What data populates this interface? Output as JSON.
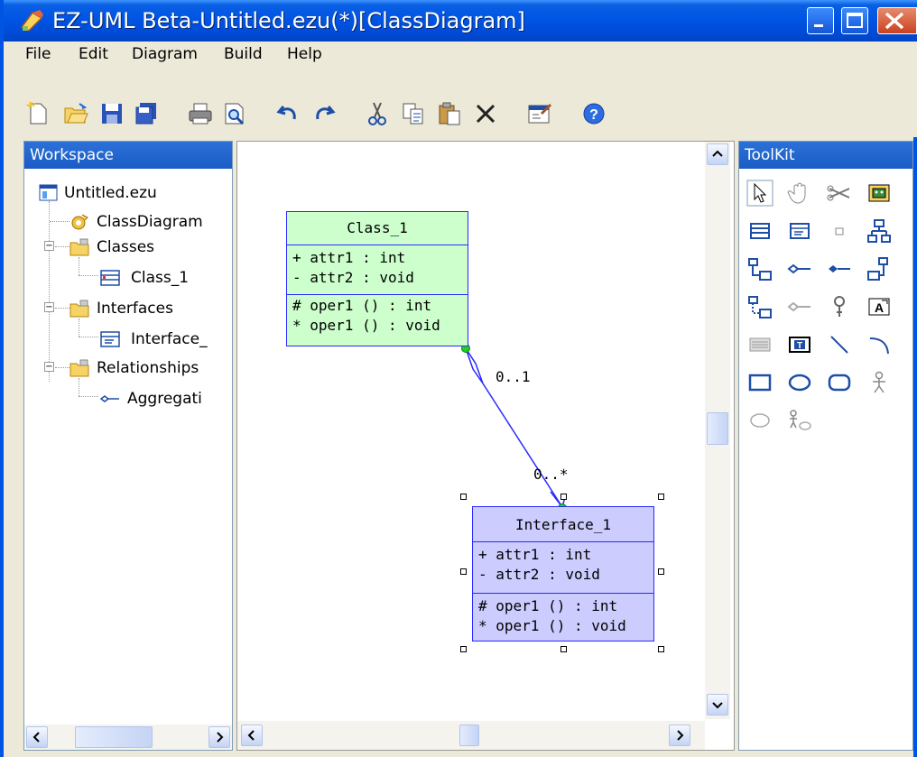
{
  "window": {
    "title": "EZ-UML Beta-Untitled.ezu(*)[ClassDiagram]"
  },
  "menu": [
    {
      "label": "File"
    },
    {
      "label": "Edit"
    },
    {
      "label": "Diagram"
    },
    {
      "label": "Build"
    },
    {
      "label": "Help"
    }
  ],
  "toolbar": [
    {
      "icon": "new-file-icon"
    },
    {
      "icon": "open-folder-icon"
    },
    {
      "icon": "save-icon"
    },
    {
      "icon": "save-all-icon"
    },
    {
      "icon": "print-icon"
    },
    {
      "icon": "print-preview-icon"
    },
    {
      "icon": "undo-icon"
    },
    {
      "icon": "redo-icon"
    },
    {
      "icon": "cut-icon"
    },
    {
      "icon": "copy-icon"
    },
    {
      "icon": "paste-icon"
    },
    {
      "icon": "delete-icon"
    },
    {
      "icon": "properties-icon"
    },
    {
      "icon": "help-icon"
    }
  ],
  "workspace": {
    "header": "Workspace",
    "tree": [
      {
        "label": "Untitled.ezu",
        "icon": "project-icon"
      },
      {
        "label": "ClassDiagram",
        "icon": "diagram-gear-icon"
      },
      {
        "label": "Classes",
        "icon": "folder-icon",
        "expander": "−"
      },
      {
        "label": "Class_1",
        "icon": "class-icon"
      },
      {
        "label": "Interfaces",
        "icon": "folder-icon",
        "expander": "−"
      },
      {
        "label": "Interface_",
        "icon": "interface-icon"
      },
      {
        "label": "Relationships",
        "icon": "folder-icon",
        "expander": "−"
      },
      {
        "label": "Aggregati",
        "icon": "aggregation-icon"
      }
    ]
  },
  "diagram": {
    "class1": {
      "name": "Class_1",
      "attr1": "+   attr1  : int",
      "attr2": "-   attr2  : void",
      "op1": "#   oper1 () : int",
      "op2": "*   oper1 () : void",
      "fill": "#ccffcc"
    },
    "interface1": {
      "name": "Interface_1",
      "attr1": "+   attr1  : int",
      "attr2": "-   attr2  : void",
      "op1": "#   oper1 () : int",
      "op2": "*   oper1 () : void",
      "fill": "#ccccff"
    },
    "relation": {
      "source_mult": "0..1",
      "target_mult": "0..*"
    }
  },
  "toolkit": {
    "header": "ToolKit",
    "icons": [
      "pointer-icon",
      "hand-icon",
      "cut-tool-icon",
      "package-icon",
      "class-tool-icon",
      "interface-tool-icon",
      "small-box-icon",
      "hierarchy-icon",
      "generalization-icon",
      "aggregation-tool-icon",
      "composition-icon",
      "dependency-icon",
      "realization-icon",
      "association-icon",
      "note-icon",
      "text-box-icon",
      "comment-icon",
      "text-frame-icon",
      "line-icon",
      "arc-icon",
      "rectangle-icon",
      "ellipse-icon",
      "rounded-rect-icon",
      "actor-icon",
      "usecase-icon",
      "actor-usecase-icon"
    ]
  },
  "colors": {
    "titlebar": "#0055e5",
    "uml_border": "#2a2aff",
    "selection_handle": "#00c000"
  }
}
